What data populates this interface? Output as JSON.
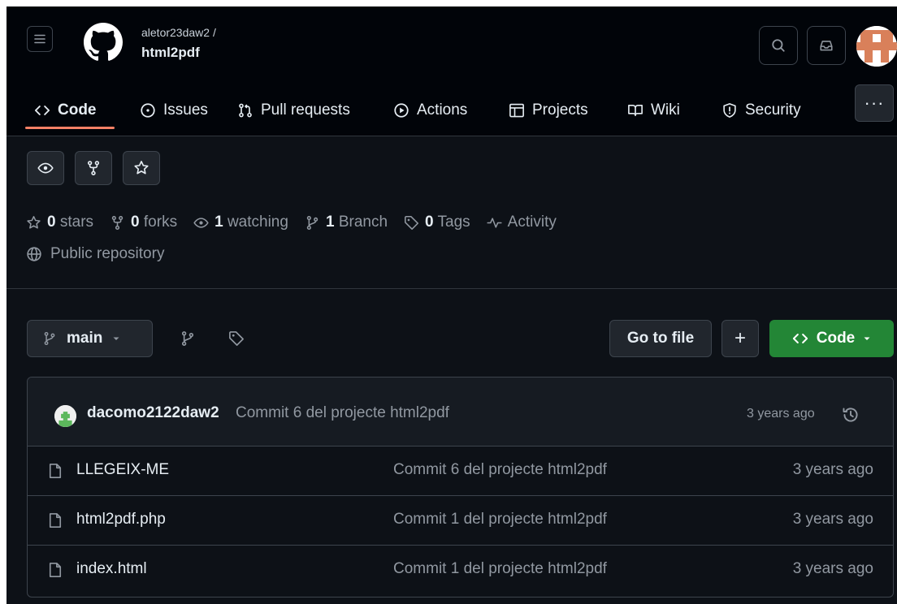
{
  "header": {
    "owner": "aletor23daw2 /",
    "repo": "html2pdf"
  },
  "nav": {
    "tabs": [
      {
        "label": "Code"
      },
      {
        "label": "Issues"
      },
      {
        "label": "Pull requests"
      },
      {
        "label": "Actions"
      },
      {
        "label": "Projects"
      },
      {
        "label": "Wiki"
      },
      {
        "label": "Security"
      }
    ],
    "more": "···"
  },
  "stats": {
    "stars_count": "0",
    "stars_label": "stars",
    "forks_count": "0",
    "forks_label": "forks",
    "watching_count": "1",
    "watching_label": "watching",
    "branch_count": "1",
    "branch_label": "Branch",
    "tags_count": "0",
    "tags_label": "Tags",
    "activity_label": "Activity"
  },
  "visibility": "Public repository",
  "toolbar": {
    "branch": "main",
    "go_to_file": "Go to file",
    "plus": "+",
    "code": "Code"
  },
  "latest_commit": {
    "author": "dacomo2122daw2",
    "message": "Commit 6 del projecte html2pdf",
    "time": "3 years ago"
  },
  "files": [
    {
      "name": "LLEGEIX-ME",
      "message": "Commit 6 del projecte html2pdf",
      "time": "3 years ago"
    },
    {
      "name": "html2pdf.php",
      "message": "Commit 1 del projecte html2pdf",
      "time": "3 years ago"
    },
    {
      "name": "index.html",
      "message": "Commit 1 del projecte html2pdf",
      "time": "3 years ago"
    }
  ],
  "colors": {
    "background": "#0d1117",
    "header": "#010409",
    "accent_underline": "#f78166",
    "code_button": "#238636",
    "muted_text": "#9198a1"
  }
}
